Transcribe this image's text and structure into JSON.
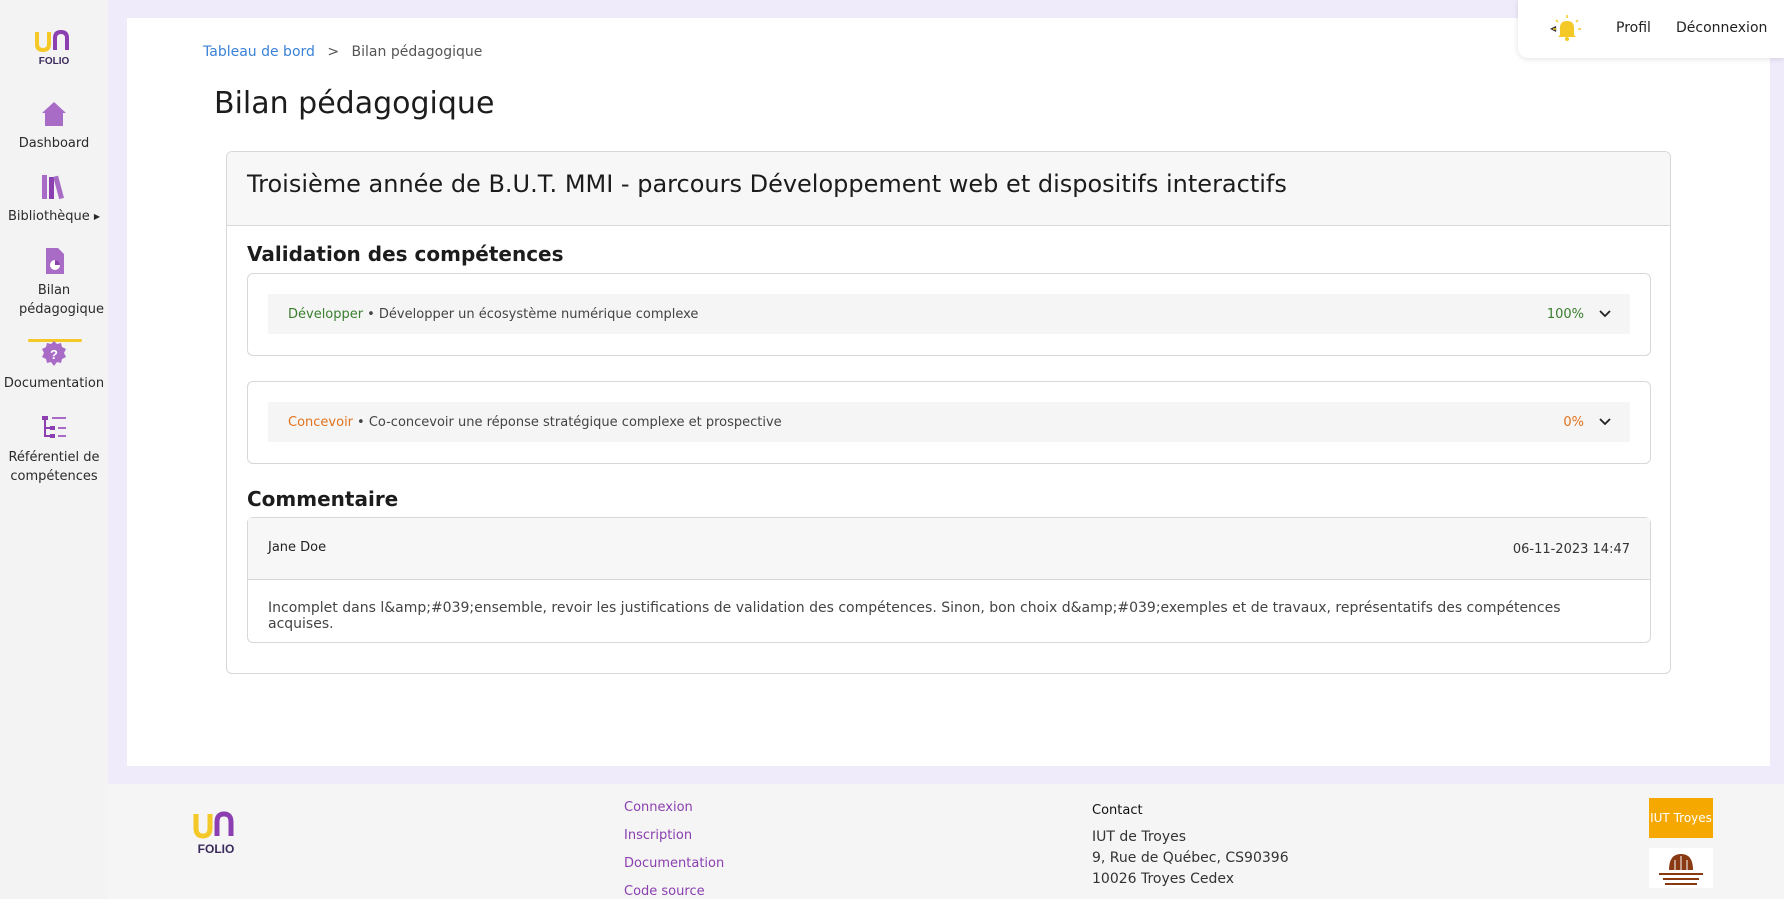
{
  "app": {
    "logo_top": "UNI",
    "logo_bottom": "FOLIO"
  },
  "sidebar": {
    "items": [
      {
        "label": "Dashboard"
      },
      {
        "label": "Bibliothèque"
      },
      {
        "label": "Bilan pédagogique"
      },
      {
        "label": "Documentation"
      },
      {
        "label": "Référentiel de compétences"
      }
    ]
  },
  "topnav": {
    "profile": "Profil",
    "logout": "Déconnexion"
  },
  "breadcrumb": {
    "home": "Tableau de bord",
    "separator": ">",
    "current": "Bilan pédagogique"
  },
  "page": {
    "title": "Bilan pédagogique"
  },
  "card": {
    "title": "Troisième année de B.U.T. MMI - parcours Développement web et dispositifs interactifs",
    "validation_title": "Validation des compétences",
    "competences": [
      {
        "name": "Développer",
        "description": "• Développer un écosystème numérique complexe",
        "percent": "100%",
        "color": "#3a7d2e"
      },
      {
        "name": "Concevoir",
        "description": "• Co-concevoir une réponse stratégique complexe et prospective",
        "percent": "0%",
        "color": "#e2731d"
      }
    ],
    "comment_title": "Commentaire",
    "comment": {
      "author": "Jane Doe",
      "date": "06-11-2023 14:47",
      "text": "Incomplet dans l&amp;#039;ensemble, revoir les justifications de validation des compétences. Sinon, bon choix d&amp;#039;exemples et de travaux, représentatifs des compétences acquises."
    }
  },
  "footer": {
    "links": [
      "Connexion",
      "Inscription",
      "Documentation",
      "Code source"
    ],
    "contact_title": "Contact",
    "contact_lines": [
      "IUT de Troyes",
      "9, Rue de Québec, CS90396",
      "10026 Troyes Cedex"
    ],
    "iut_logo": "IUT Troyes"
  },
  "colors": {
    "accent": "#8b3fb0",
    "brand_yellow": "#f4c826",
    "link_blue": "#3b82d6"
  },
  "icons": [
    "home-icon",
    "books-icon",
    "document-icon",
    "help-icon",
    "tree-list-icon",
    "bell-icon",
    "chevron-down-icon"
  ]
}
